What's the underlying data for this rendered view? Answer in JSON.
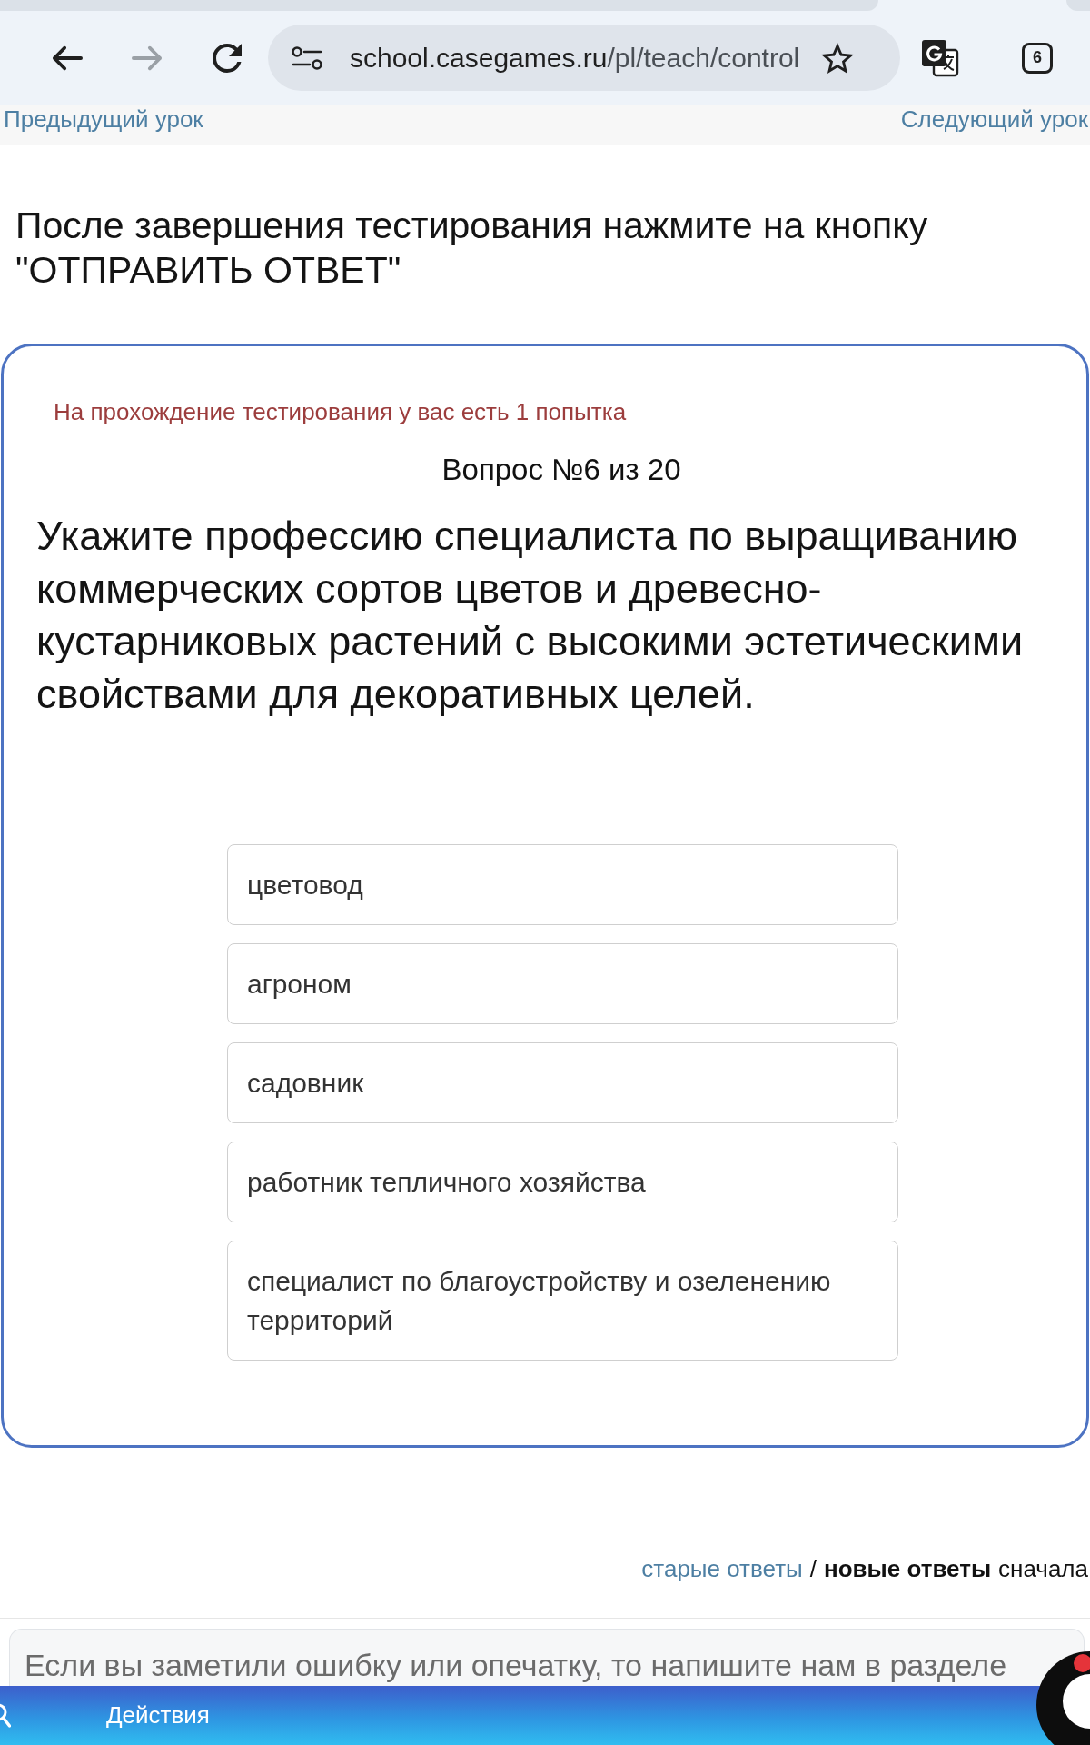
{
  "browser": {
    "url_host": "school.casegames.ru",
    "url_path": "/pl/teach/control",
    "forward_enabled": false,
    "tab_count": "6"
  },
  "lesson_nav": {
    "previous": "Предыдущий урок",
    "next": "Следующий урок"
  },
  "instruction": "После завершения тестирования нажмите на кнопку \"ОТПРАВИТЬ ОТВЕТ\"",
  "quiz": {
    "attempts_notice": "На прохождение тестирования у вас есть 1 попытка",
    "question_number": "Вопрос №6 из 20",
    "question": "Укажите профессию специалиста по выращиванию коммерческих сортов цветов и древесно-кустарниковых растений с высокими эстетическими свойствами для декоративных целей.",
    "answers": [
      {
        "text": "цветовод",
        "selected": false
      },
      {
        "text": "агроном",
        "selected": false
      },
      {
        "text": "садовник",
        "selected": false
      },
      {
        "text": "работник тепличного хозяйства",
        "selected": false
      },
      {
        "text": "специалист по благоустройству и озеленению территорий",
        "selected": false
      }
    ]
  },
  "answer_sort": {
    "options": [
      {
        "label": "старые ответы",
        "selected": false
      },
      {
        "label": "новые ответы",
        "selected": true
      }
    ],
    "separator": "/",
    "suffix": "сначала"
  },
  "feedback_field": {
    "placeholder": "Если вы заметили ошибку или опечатку, то напишите нам в разделе"
  },
  "bottom_bar": {
    "label": "Действия"
  }
}
